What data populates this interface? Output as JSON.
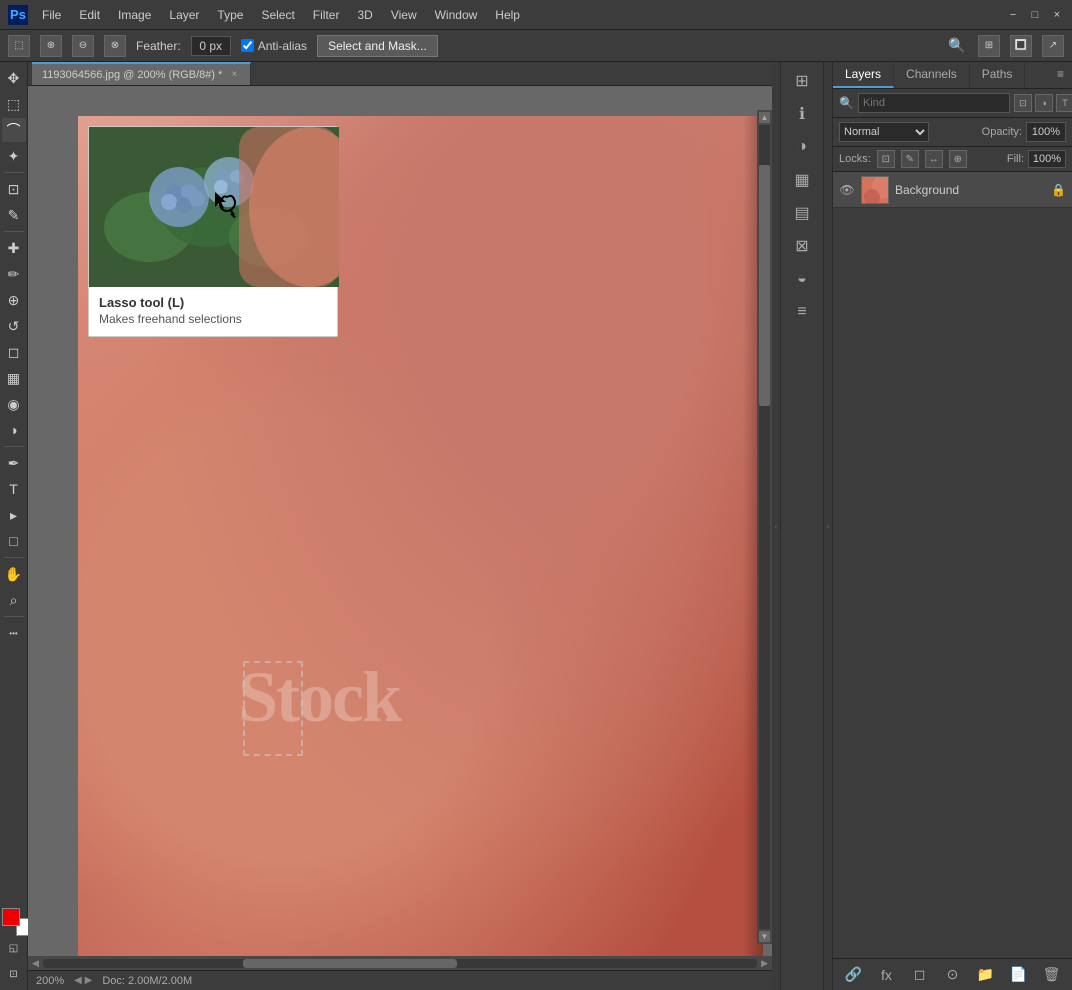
{
  "titlebar": {
    "logo": "Ps",
    "menus": [
      "File",
      "Edit",
      "Image",
      "Layer",
      "Type",
      "Select",
      "Filter",
      "3D",
      "View",
      "Window",
      "Help"
    ],
    "win_buttons": [
      "−",
      "□",
      "×"
    ]
  },
  "optionsbar": {
    "feather_label": "Feather:",
    "feather_value": "0 px",
    "antialias_label": "Anti-alias",
    "select_mask_btn": "Select and Mask...",
    "tool_icons": [
      "rectangle-select-icon",
      "subtract-icon",
      "intersect-icon",
      "add-icon"
    ]
  },
  "toolbar": {
    "tools": [
      {
        "name": "move-tool",
        "icon": "✥"
      },
      {
        "name": "selection-tool",
        "icon": "⬚"
      },
      {
        "name": "lasso-tool",
        "icon": "⌒"
      },
      {
        "name": "magic-wand-tool",
        "icon": "✦"
      },
      {
        "name": "crop-tool",
        "icon": "⊡"
      },
      {
        "name": "eyedropper-tool",
        "icon": "✎"
      },
      {
        "name": "healing-tool",
        "icon": "✚"
      },
      {
        "name": "brush-tool",
        "icon": "✏"
      },
      {
        "name": "stamp-tool",
        "icon": "⊕"
      },
      {
        "name": "history-brush-tool",
        "icon": "↺"
      },
      {
        "name": "eraser-tool",
        "icon": "◻"
      },
      {
        "name": "gradient-tool",
        "icon": "▦"
      },
      {
        "name": "blur-tool",
        "icon": "◉"
      },
      {
        "name": "dodge-tool",
        "icon": "◑"
      },
      {
        "name": "pen-tool",
        "icon": "✒"
      },
      {
        "name": "type-tool",
        "icon": "T"
      },
      {
        "name": "path-select-tool",
        "icon": "▸"
      },
      {
        "name": "shape-tool",
        "icon": "□"
      },
      {
        "name": "hand-tool",
        "icon": "✋"
      },
      {
        "name": "zoom-tool",
        "icon": "⌕"
      },
      {
        "name": "more-tools",
        "icon": "···"
      }
    ],
    "foreground_color": "#cc0000",
    "background_color": "#ffffff"
  },
  "tab": {
    "filename": "1193064566.jpg @ 200% (RGB/8#) *",
    "close_icon": "×"
  },
  "tool_preview": {
    "tool_name": "Lasso tool (L)",
    "tool_desc": "Makes freehand selections"
  },
  "watermark": {
    "text": "Stock"
  },
  "statusbar": {
    "zoom": "200%",
    "doc_info": "Doc: 2.00M/2.00M"
  },
  "mid_toolbar": {
    "icons": [
      "⊞",
      "⊟",
      "⊕",
      "◱"
    ]
  },
  "layers_panel": {
    "tabs": [
      {
        "label": "Layers",
        "active": true
      },
      {
        "label": "Channels",
        "active": false
      },
      {
        "label": "Paths",
        "active": false
      }
    ],
    "search_placeholder": "Kind",
    "blend_mode": "Normal",
    "opacity_label": "Opacity:",
    "opacity_value": "100%",
    "lock_label": "Locks:",
    "lock_icons": [
      "⊡",
      "✎",
      "↔",
      "⊕"
    ],
    "fill_label": "Fill:",
    "fill_value": "100%",
    "layers": [
      {
        "name": "Background",
        "visible": true,
        "locked": true
      }
    ],
    "bottom_buttons": [
      "⊕",
      "fx",
      "◻",
      "⊙",
      "📁",
      "🗑"
    ]
  }
}
